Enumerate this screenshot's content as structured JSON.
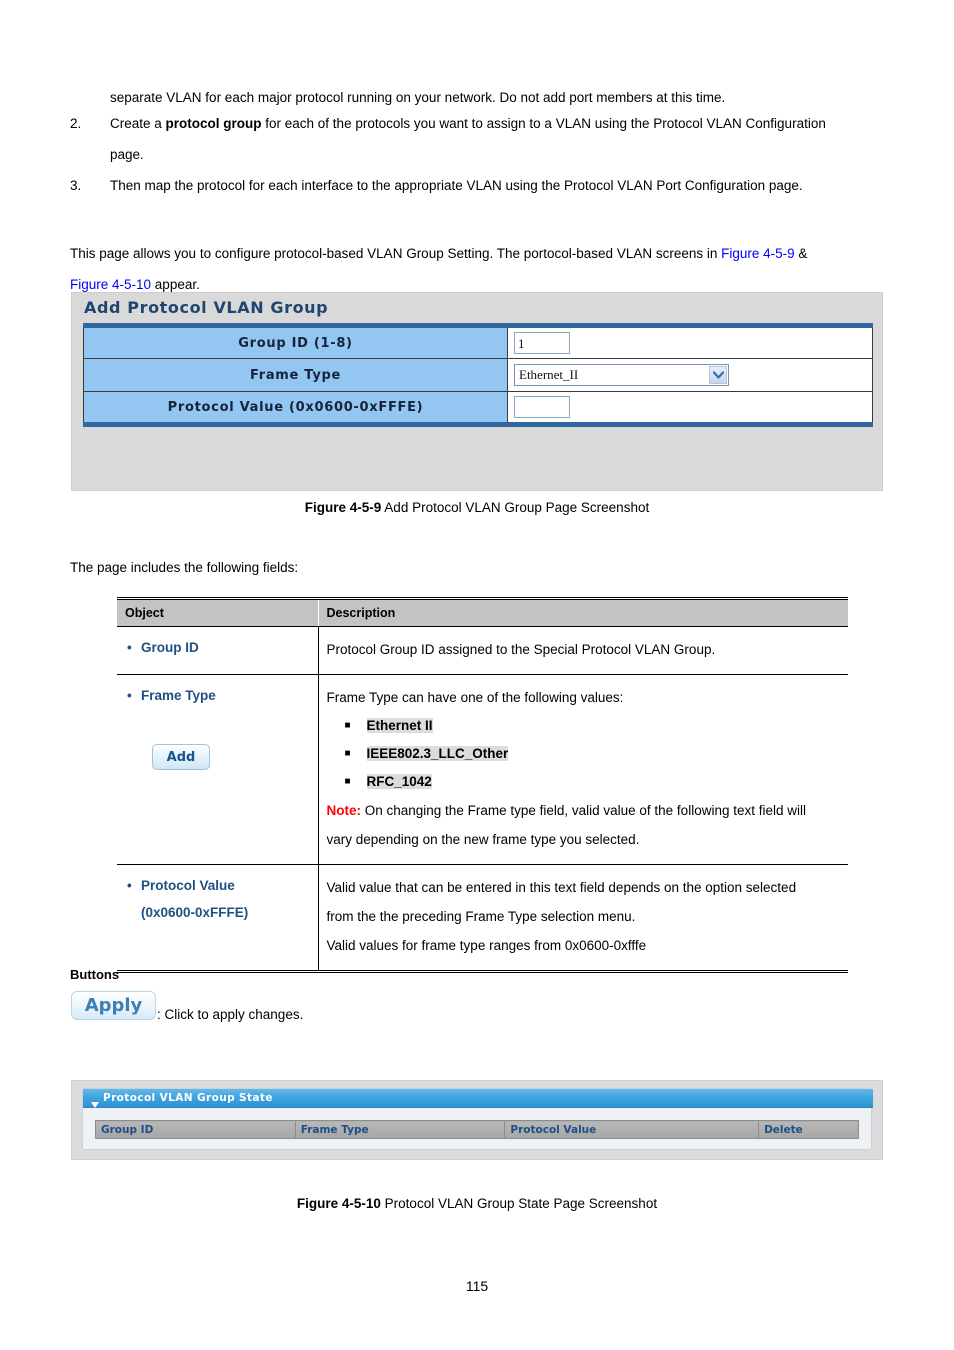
{
  "intro": {
    "lead_line": "separate VLAN for each major protocol running on your network. Do not add port members at this time.",
    "steps": [
      {
        "num": "2.",
        "pre": "Create a ",
        "strong": "protocol group",
        "post": " for each of the protocols you want to assign to a VLAN using the Protocol VLAN Configuration",
        "cont": "page."
      },
      {
        "num": "3.",
        "pre": "Then map the protocol for each interface to the appropriate VLAN using the Protocol VLAN Port Configuration page.",
        "strong": "",
        "post": "",
        "cont": ""
      }
    ],
    "paragraph_pre": "This page allows you to configure protocol-based VLAN Group Setting. The portocol-based VLAN screens in ",
    "link1": "Figure 4-5-9",
    "paragraph_mid": " &",
    "link2": "Figure 4-5-10",
    "paragraph_post": " appear."
  },
  "figure1": {
    "title": "Add Protocol VLAN Group",
    "rows": [
      {
        "label": "Group ID (1-8)",
        "control": "textbox",
        "value": "1"
      },
      {
        "label": "Frame Type",
        "control": "select",
        "value": "Ethernet_II"
      },
      {
        "label": "Protocol Value (0x0600-0xFFFE)",
        "control": "textbox",
        "value": ""
      }
    ],
    "add_button": "Add",
    "caption_bold": "Figure 4-5-9",
    "caption_rest": " Add Protocol VLAN Group Page Screenshot"
  },
  "fields_intro": "The page includes the following fields:",
  "desc_table": {
    "headers": [
      "Object",
      "Description"
    ],
    "rows": [
      {
        "object": "Group ID",
        "object_sub": "",
        "lines": [
          "Protocol Group ID assigned to the Special Protocol VLAN Group."
        ]
      },
      {
        "object": "Frame Type",
        "object_sub": "",
        "lead": "Frame Type can have one of the following values:",
        "bullets": [
          "Ethernet II",
          "IEEE802.3_LLC_Other",
          "RFC_1042"
        ],
        "note_label": "Note:",
        "note_text": " On changing the Frame type field, valid value of the following text field will",
        "note_cont": "vary depending on the new frame type you selected."
      },
      {
        "object": "Protocol Value",
        "object_sub": "(0x0600-0xFFFE)",
        "lines": [
          "Valid value that can be entered in this text field depends on the option selected",
          "from the the preceding Frame Type selection menu.",
          "Valid values for frame type ranges from 0x0600-0xfffe"
        ]
      }
    ]
  },
  "buttons_section": {
    "heading": "Buttons",
    "apply_label": "Apply",
    "apply_desc": ": Click to apply changes."
  },
  "figure2": {
    "panel_title": "Protocol VLAN Group State",
    "headers": [
      "Group ID",
      "Frame Type",
      "Protocol Value",
      "Delete"
    ],
    "caption_bold": "Figure 4-5-10",
    "caption_rest": " Protocol VLAN Group State Page Screenshot"
  },
  "page_number": "115"
}
